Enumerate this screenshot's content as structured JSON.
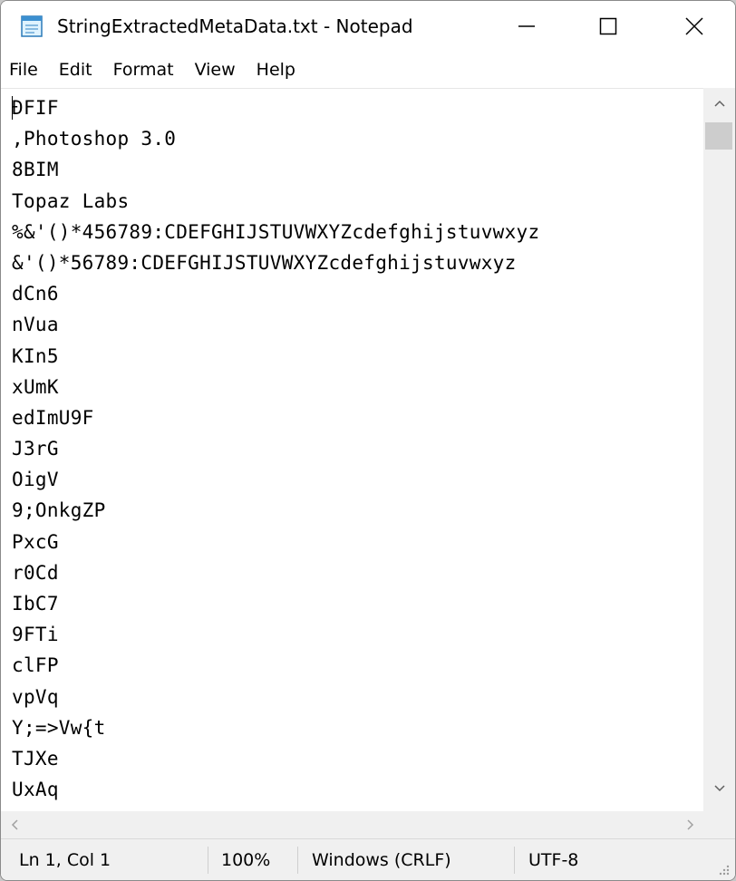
{
  "window": {
    "title": "StringExtractedMetaData.txt - Notepad",
    "app_icon": "notepad-icon"
  },
  "menu": [
    "File",
    "Edit",
    "Format",
    "View",
    "Help"
  ],
  "editor": {
    "lines": [
      "ÐFIF",
      ",Photoshop 3.0",
      "8BIM",
      "Topaz Labs",
      "%&'()*456789:CDEFGHIJSTUVWXYZcdefghijstuvwxyz",
      "&'()*56789:CDEFGHIJSTUVWXYZcdefghijstuvwxyz",
      "dCn6",
      "nVua",
      "KIn5",
      "xUmK",
      "edImU9F",
      "J3rG",
      "OigV",
      "9;OnkgZP",
      "PxcG",
      "r0Cd",
      "IbC7",
      "9FTi",
      "clFP",
      "vpVq",
      "Y;=>Vw{t",
      "TJXe",
      "UxAq"
    ]
  },
  "status": {
    "position": "Ln 1, Col 1",
    "zoom": "100%",
    "line_ending": "Windows (CRLF)",
    "encoding": "UTF-8"
  }
}
